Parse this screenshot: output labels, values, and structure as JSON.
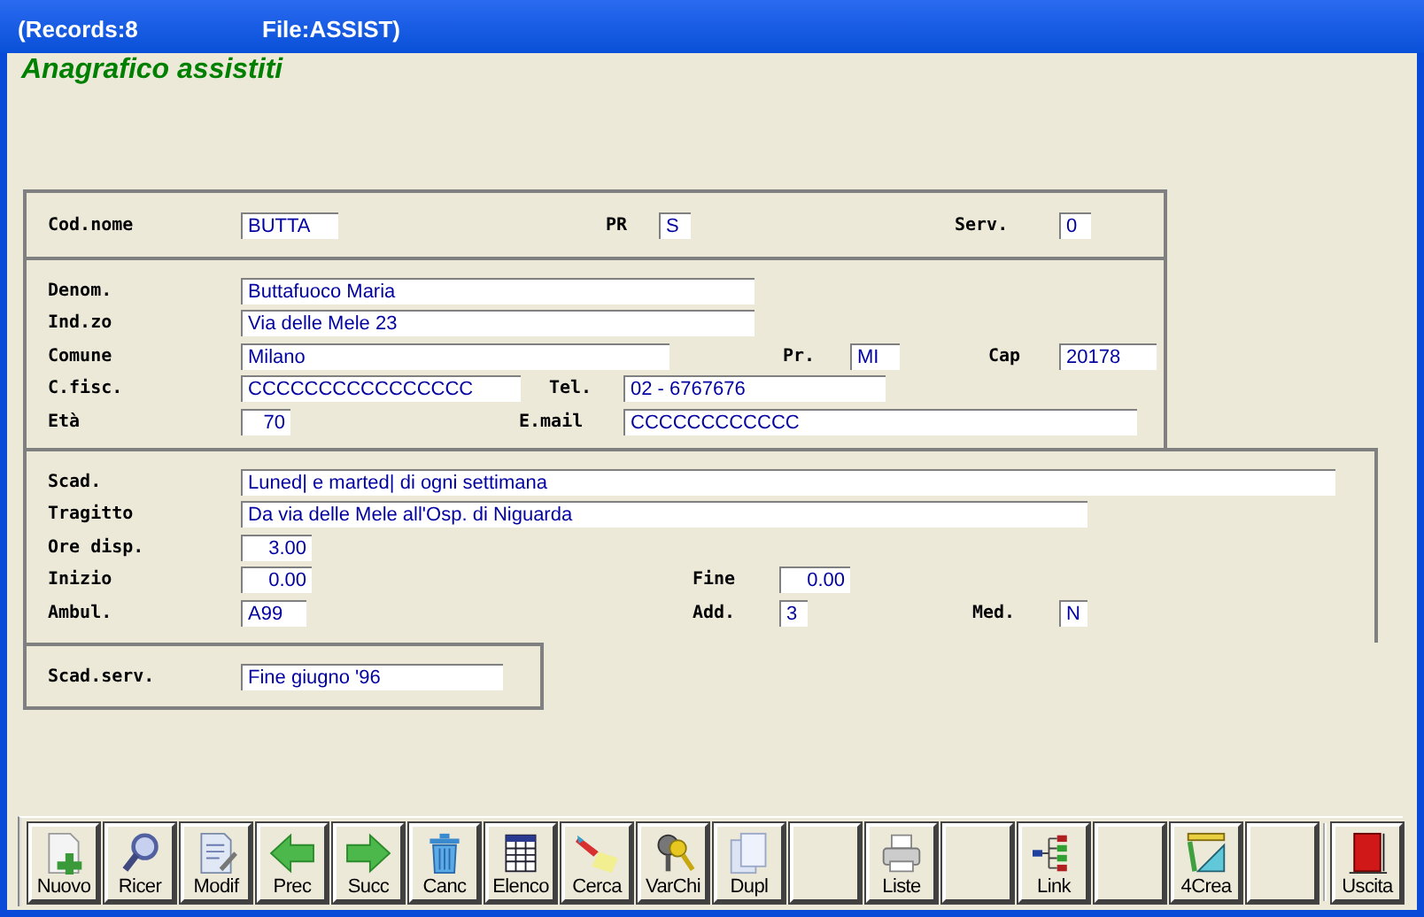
{
  "title_bar": {
    "records": "(Records:8",
    "file": "File:ASSIST)"
  },
  "heading": "Anagrafico assistiti",
  "panels": [
    {
      "rows": [
        {
          "fields": [
            {
              "label": "Cod.nome",
              "value": "BUTTA",
              "kind": "text"
            },
            {
              "label": "PR",
              "value": "S",
              "kind": "text"
            },
            {
              "label": "Serv.",
              "value": "0",
              "kind": "text"
            }
          ]
        }
      ]
    },
    {
      "rows": [
        {
          "fields": [
            {
              "label": "Denom.",
              "value": "Buttafuoco Maria",
              "kind": "text"
            }
          ]
        },
        {
          "fields": [
            {
              "label": "Ind.zo",
              "value": "Via delle Mele 23",
              "kind": "text"
            }
          ]
        },
        {
          "fields": [
            {
              "label": "Comune",
              "value": "Milano",
              "kind": "text"
            },
            {
              "label": "Pr.",
              "value": "MI",
              "kind": "text"
            },
            {
              "label": "Cap",
              "value": "20178",
              "kind": "text"
            }
          ]
        },
        {
          "fields": [
            {
              "label": "C.fisc.",
              "value": "CCCCCCCCCCCCCCCC",
              "kind": "text"
            },
            {
              "label": "Tel.",
              "value": "02 - 6767676",
              "kind": "text"
            }
          ]
        },
        {
          "fields": [
            {
              "label": "Età",
              "value": "70",
              "kind": "number"
            },
            {
              "label": "E.mail",
              "value": "CCCCCCCCCCCC",
              "kind": "text"
            }
          ]
        }
      ]
    },
    {
      "rows": [
        {
          "fields": [
            {
              "label": "Scad.",
              "value": "Luned| e marted| di ogni settimana",
              "kind": "text"
            }
          ]
        },
        {
          "fields": [
            {
              "label": "Tragitto",
              "value": "Da via delle Mele all'Osp. di Niguarda",
              "kind": "text"
            }
          ]
        },
        {
          "fields": [
            {
              "label": "Ore disp.",
              "value": "3.00",
              "kind": "number"
            }
          ]
        },
        {
          "fields": [
            {
              "label": "Inizio",
              "value": "0.00",
              "kind": "number"
            },
            {
              "label": "Fine",
              "value": "0.00",
              "kind": "number"
            }
          ]
        },
        {
          "fields": [
            {
              "label": "Ambul.",
              "value": "A99",
              "kind": "text"
            },
            {
              "label": "Add.",
              "value": "3",
              "kind": "text"
            },
            {
              "label": "Med.",
              "value": "N",
              "kind": "text"
            }
          ]
        }
      ]
    },
    {
      "rows": [
        {
          "fields": [
            {
              "label": "Scad.serv.",
              "value": "Fine giugno '96",
              "kind": "text"
            }
          ]
        }
      ]
    }
  ],
  "toolbar": [
    {
      "kind": "new",
      "label": "Nuovo"
    },
    {
      "kind": "magnifier",
      "label": "Ricer"
    },
    {
      "kind": "edit",
      "label": "Modif"
    },
    {
      "kind": "left",
      "label": "Prec"
    },
    {
      "kind": "right",
      "label": "Succ"
    },
    {
      "kind": "trash",
      "label": "Canc"
    },
    {
      "kind": "table",
      "label": "Elenco"
    },
    {
      "kind": "torch",
      "label": "Cerca"
    },
    {
      "kind": "keys",
      "label": "VarChi"
    },
    {
      "kind": "copy",
      "label": "Dupl"
    },
    {
      "kind": "blank"
    },
    {
      "kind": "printer",
      "label": "Liste"
    },
    {
      "kind": "blank"
    },
    {
      "kind": "tree",
      "label": "Link"
    },
    {
      "kind": "blank"
    },
    {
      "kind": "ruler",
      "label": "4Crea"
    },
    {
      "kind": "blank"
    },
    {
      "kind": "door",
      "label": "Uscita"
    }
  ]
}
